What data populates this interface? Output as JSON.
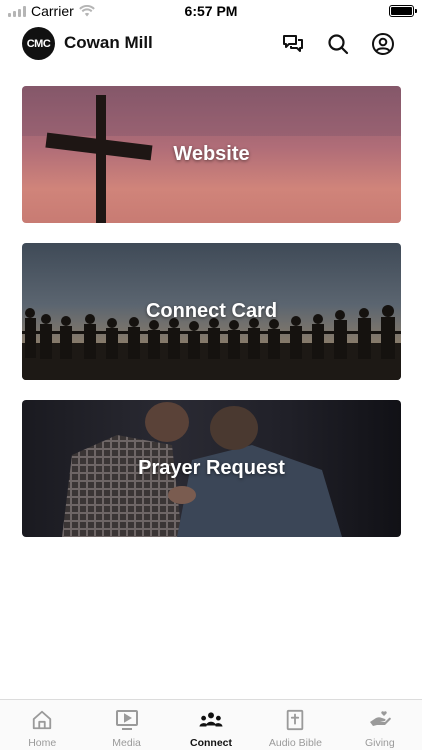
{
  "status_bar": {
    "carrier": "Carrier",
    "time": "6:57 PM",
    "battery_level": 1.0
  },
  "header": {
    "logo_text": "CMC",
    "title": "Cowan Mill",
    "icons": [
      "chat-icon",
      "search-icon",
      "profile-icon"
    ]
  },
  "cards": [
    {
      "label": "Website"
    },
    {
      "label": "Connect Card"
    },
    {
      "label": "Prayer Request"
    }
  ],
  "tabs": [
    {
      "label": "Home",
      "icon": "home-icon",
      "active": false
    },
    {
      "label": "Media",
      "icon": "play-icon",
      "active": false
    },
    {
      "label": "Connect",
      "icon": "group-icon",
      "active": true
    },
    {
      "label": "Audio Bible",
      "icon": "bible-icon",
      "active": false
    },
    {
      "label": "Giving",
      "icon": "giving-hand-icon",
      "active": false
    }
  ],
  "colors": {
    "active_tab": "#111111",
    "inactive_tab": "#9a9a9a",
    "background": "#ffffff"
  }
}
